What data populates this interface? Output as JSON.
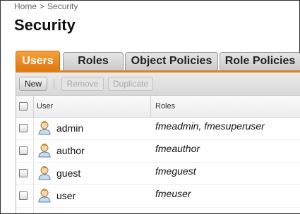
{
  "breadcrumb": {
    "home": "Home",
    "separator": ">",
    "current": "Security"
  },
  "page": {
    "title": "Security"
  },
  "tabs": [
    {
      "label": "Users",
      "active": true
    },
    {
      "label": "Roles",
      "active": false
    },
    {
      "label": "Object Policies",
      "active": false
    },
    {
      "label": "Role Policies",
      "active": false
    }
  ],
  "toolbar": {
    "new_label": "New",
    "remove_label": "Remove",
    "duplicate_label": "Duplicate"
  },
  "table": {
    "columns": [
      "User",
      "Roles"
    ],
    "rows": [
      {
        "user": "admin",
        "roles": "fmeadmin, fmesuperuser"
      },
      {
        "user": "author",
        "roles": "fmeauthor"
      },
      {
        "user": "guest",
        "roles": "fmeguest"
      },
      {
        "user": "user",
        "roles": "fmeuser"
      }
    ]
  },
  "colors": {
    "active_tab": "#e88a22",
    "tab_inactive": "#d4d4d4"
  },
  "icons": {
    "row_user": "user-icon"
  }
}
